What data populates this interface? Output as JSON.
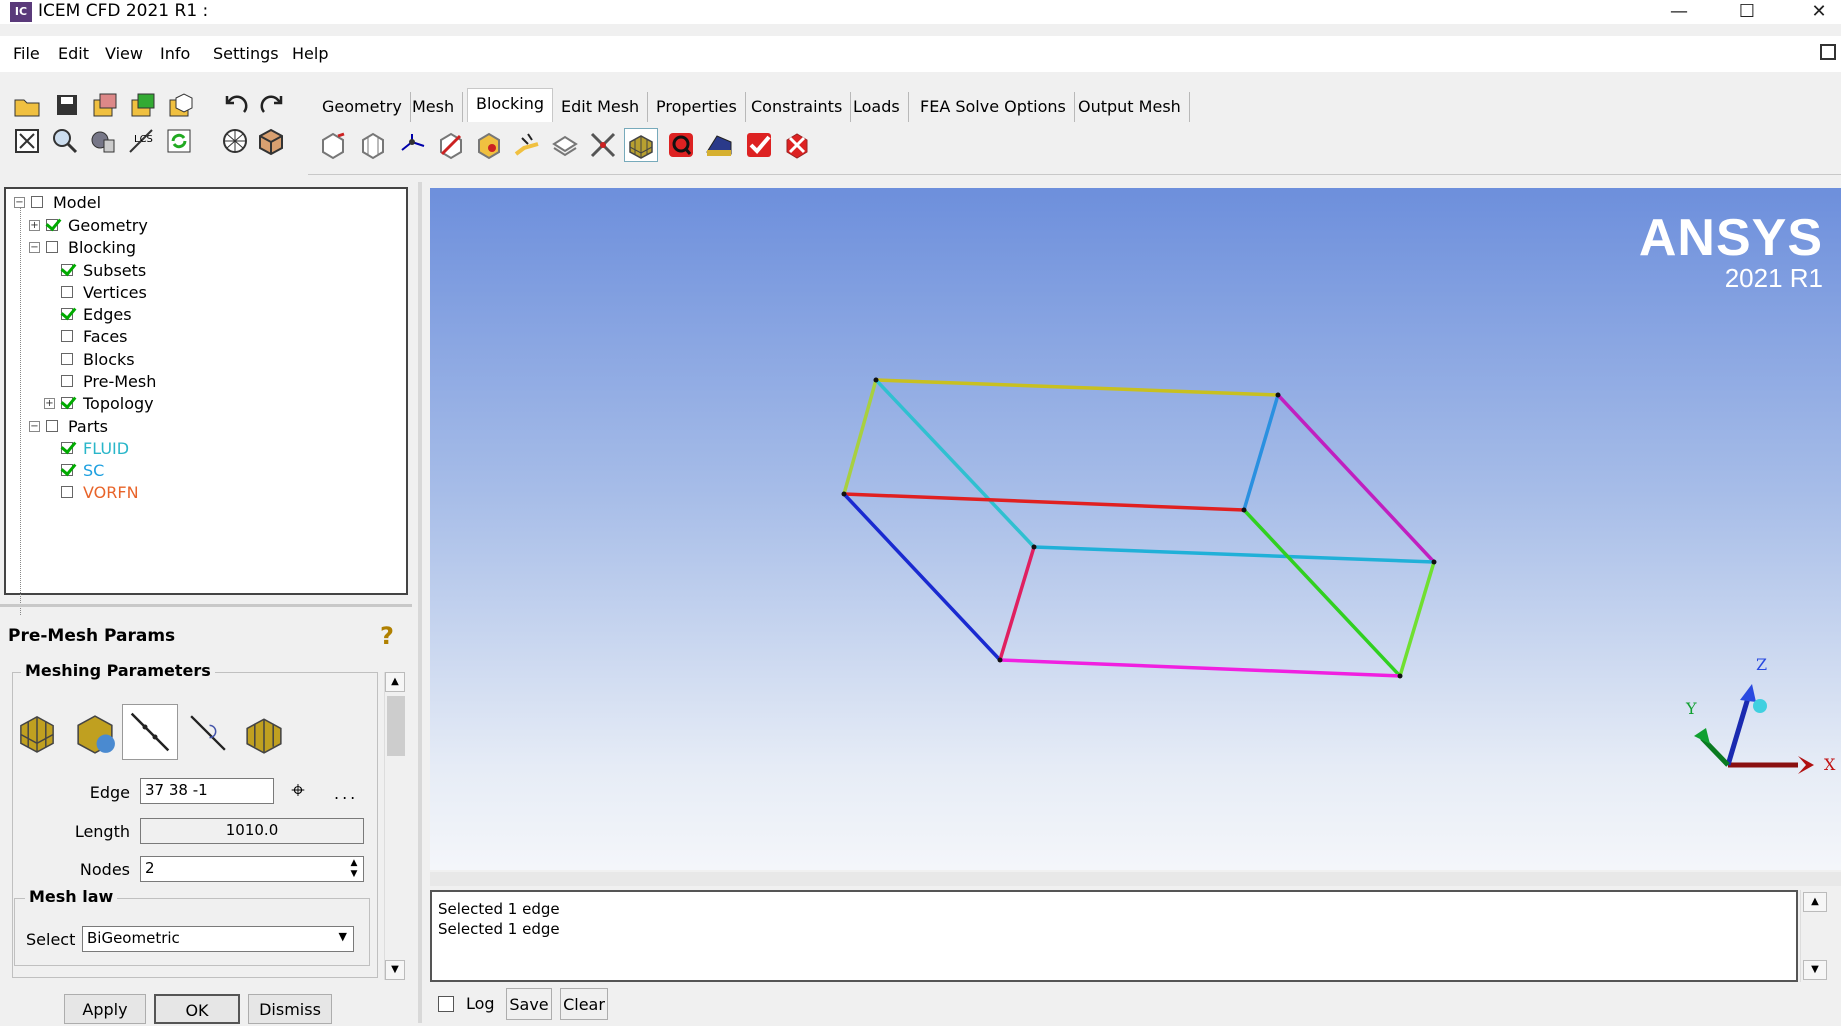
{
  "window": {
    "title": "ICEM CFD 2021 R1 :",
    "app_icon": "IC",
    "minimize": "—",
    "maximize": "☐",
    "close": "✕"
  },
  "menu": [
    "File",
    "Edit",
    "View",
    "Info",
    "Settings",
    "Help"
  ],
  "tabs": [
    "Geometry",
    "Mesh",
    "Blocking",
    "Edit Mesh",
    "Properties",
    "Constraints",
    "Loads",
    "FEA Solve Options",
    "Output Mesh"
  ],
  "active_tab": "Blocking",
  "tree": {
    "model": "Model",
    "geometry": "Geometry",
    "blocking": "Blocking",
    "subsets": "Subsets",
    "vertices": "Vertices",
    "edges": "Edges",
    "faces": "Faces",
    "blocks": "Blocks",
    "premesh": "Pre-Mesh",
    "topology": "Topology",
    "parts": "Parts",
    "fluid": "FLUID",
    "sc": "SC",
    "vorfn": "VORFN"
  },
  "colors": {
    "fluid": "#29b6c9",
    "sc": "#1ea0e0",
    "vorfn": "#e8642a",
    "check": "#00aa00"
  },
  "params": {
    "title": "Pre-Mesh Params",
    "meshing_parameters": "Meshing Parameters",
    "edge_label": "Edge",
    "edge_value": "37 38 -1",
    "ellipsis": "...",
    "length_label": "Length",
    "length_value": "1010.0",
    "nodes_label": "Nodes",
    "nodes_value": "2",
    "mesh_law": "Mesh law",
    "select_label": "Select",
    "select_value": "BiGeometric"
  },
  "buttons": {
    "apply": "Apply",
    "ok": "OK",
    "dismiss": "Dismiss"
  },
  "viewport": {
    "logo": "ANSYS",
    "version": "2021 R1",
    "axis_x": "X",
    "axis_y": "Y",
    "axis_z": "Z"
  },
  "messages": [
    "Selected 1 edge",
    "Selected 1 edge"
  ],
  "msg_controls": {
    "log": "Log",
    "save": "Save",
    "clear": "Clear"
  }
}
